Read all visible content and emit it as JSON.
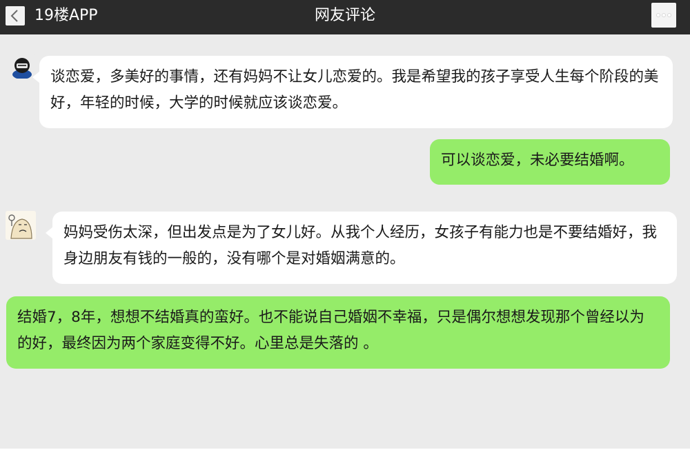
{
  "header": {
    "back_label": "<",
    "app_name": "19楼APP",
    "title": "网友评论",
    "more_label": "···"
  },
  "colors": {
    "header_bg": "#2b2b2b",
    "page_bg": "#ebebeb",
    "bubble_white": "#ffffff",
    "bubble_green": "#95ec69"
  },
  "comments": [
    {
      "side": "left",
      "avatar_icon": "hooded-avatar-icon",
      "text": "谈恋爱，多美好的事情，还有妈妈不让女儿恋爱的。我是希望我的孩子享受人生每个阶段的美好，年轻的时候，大学的时候就应该谈恋爱。"
    },
    {
      "side": "right",
      "text": "可以谈恋爱，未必要结婚啊。"
    },
    {
      "side": "left",
      "avatar_icon": "sketch-avatar-icon",
      "text": "妈妈受伤太深，但出发点是为了女儿好。从我个人经历，女孩子有能力也是不要结婚好，我身边朋友有钱的一般的，没有哪个是对婚姻满意的。"
    },
    {
      "side": "right",
      "text": "结婚7，8年，想想不结婚真的蛮好。也不能说自己婚姻不幸福，只是偶尔想想发现那个曾经以为的好，最终因为两个家庭变得不好。心里总是失落的 。"
    }
  ]
}
